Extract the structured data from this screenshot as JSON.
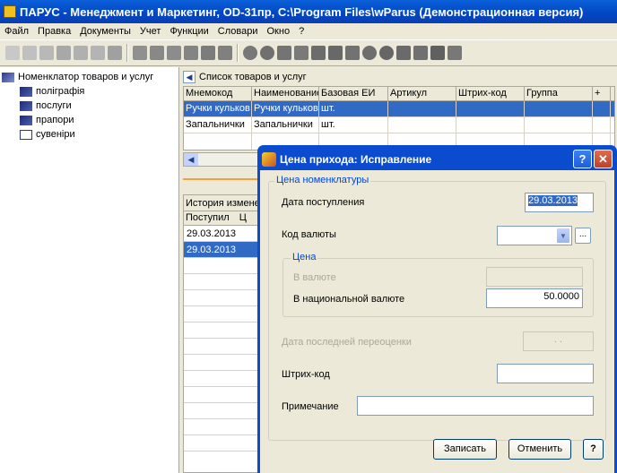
{
  "window": {
    "title": "ПАРУС - Менеджмент и Маркетинг, OD-31пр, C:\\Program Files\\wParus (Демонстрационная версия)"
  },
  "menu": [
    "Файл",
    "Правка",
    "Документы",
    "Учет",
    "Функции",
    "Словари",
    "Окно",
    "?"
  ],
  "toolbar": {
    "icons": [
      "new-icon",
      "copy-icon",
      "edit-icon",
      "delete-icon",
      "filter-icon",
      "print-icon",
      "box-icon",
      "truck-icon",
      "monitor-icon",
      "document-icon",
      "folder-icon",
      "stack-icon",
      "user-icon",
      "gear-icon",
      "transfer-icon",
      "check-icon",
      "chart-icon",
      "calculator-icon",
      "package-icon",
      "clock-icon",
      "mail-icon",
      "settings-icon",
      "grid-icon"
    ]
  },
  "tree": {
    "root": "Номенклатор товаров и услуг",
    "items": [
      "поліграфія",
      "послуги",
      "прапори",
      "сувеніри"
    ]
  },
  "list": {
    "title": "Список товаров и услуг",
    "columns": [
      "Мнемокод",
      "Наименование",
      "Базовая ЕИ",
      "Артикул",
      "Штрих-код",
      "Группа",
      "+"
    ],
    "rows": [
      [
        "Ручки кульков",
        "Ручки кульков",
        "шт.",
        "",
        "",
        "",
        ""
      ],
      [
        "Запальнички",
        "Запальнички",
        "шт.",
        "",
        "",
        "",
        ""
      ]
    ]
  },
  "history": {
    "title": "История изменений",
    "column": "Поступил",
    "column2": "Ц",
    "rows": [
      "29.03.2013",
      "29.03.2013"
    ]
  },
  "dialog": {
    "title": "Цена прихода: Исправление",
    "group_title": "Цена номенклатуры",
    "date_label": "Дата поступления",
    "date_value": "29.03.2013",
    "currency_label": "Код валюты",
    "currency_value": "",
    "price_group": "Цена",
    "in_currency_label": "В валюте",
    "in_currency_value": "",
    "national_label": "В национальной валюте",
    "national_value": "50.0000",
    "last_reval_label": "Дата последней переоценки",
    "last_reval_value": ". .",
    "barcode_label": "Штрих-код",
    "barcode_value": "",
    "note_label": "Примечание",
    "note_value": "",
    "save_label": "Записать",
    "cancel_label": "Отменить",
    "help_label": "?"
  }
}
